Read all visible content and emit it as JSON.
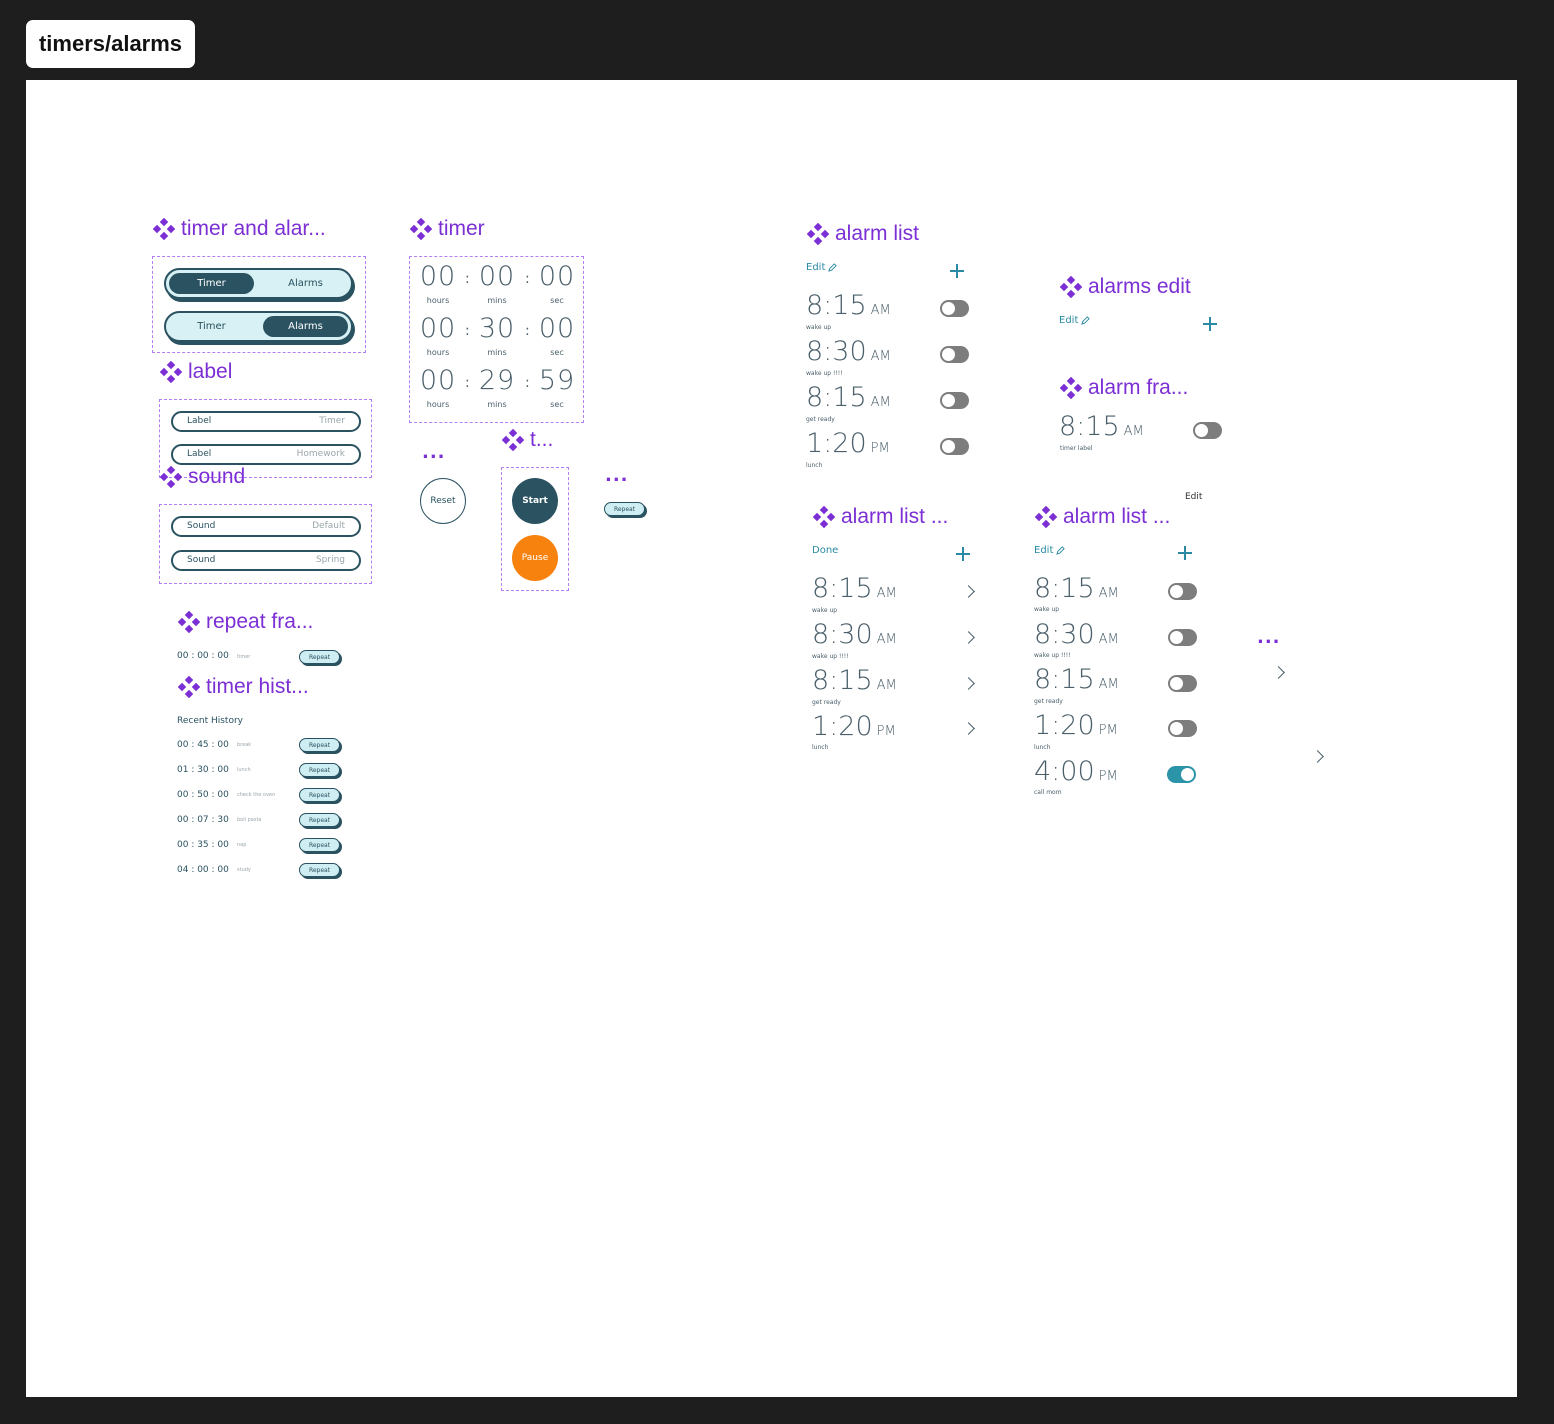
{
  "frame_title": "timers/alarms",
  "components": {
    "toggle_group": {
      "title": "timer and alar...",
      "rows": [
        {
          "left": "Timer",
          "right": "Alarms",
          "active": "left"
        },
        {
          "left": "Timer",
          "right": "Alarms",
          "active": "right"
        }
      ]
    },
    "label": {
      "title": "label",
      "rows": [
        {
          "name": "Label",
          "value": "Timer"
        },
        {
          "name": "Label",
          "value": "Homework"
        }
      ]
    },
    "sound": {
      "title": "sound",
      "rows": [
        {
          "name": "Sound",
          "value": "Default"
        },
        {
          "name": "Sound",
          "value": "Spring"
        }
      ]
    },
    "timer": {
      "title": "timer",
      "rows": [
        {
          "h": "00",
          "m": "00",
          "s": "00"
        },
        {
          "h": "00",
          "m": "30",
          "s": "00"
        },
        {
          "h": "00",
          "m": "29",
          "s": "59"
        }
      ],
      "labels": {
        "hours": "hours",
        "mins": "mins",
        "sec": "sec"
      },
      "colon": ":"
    },
    "reset": {
      "dots": "...",
      "label": "Reset"
    },
    "timer_controls": {
      "title": "t...",
      "start": "Start",
      "pause": "Pause"
    },
    "repeat_button": {
      "dots": "...",
      "label": "Repeat"
    },
    "repeat_frame": {
      "title": "repeat fra...",
      "time": "00 : 00 : 00",
      "note": "timer",
      "button": "Repeat"
    },
    "timer_history": {
      "title": "timer hist...",
      "heading": "Recent History",
      "items": [
        {
          "time": "00 : 45 : 00",
          "note": "break",
          "button": "Repeat"
        },
        {
          "time": "01 : 30 : 00",
          "note": "lunch",
          "button": "Repeat"
        },
        {
          "time": "00 : 50 : 00",
          "note": "check the oven",
          "button": "Repeat"
        },
        {
          "time": "00 : 07 : 30",
          "note": "boil pasta",
          "button": "Repeat"
        },
        {
          "time": "00 : 35 : 00",
          "note": "nap",
          "button": "Repeat"
        },
        {
          "time": "04 : 00 : 00",
          "note": "study",
          "button": "Repeat"
        }
      ]
    },
    "alarm_list": {
      "title": "alarm list",
      "edit": "Edit",
      "items": [
        {
          "time": "8:15",
          "ampm": "AM",
          "note": "wake up",
          "on": false
        },
        {
          "time": "8:30",
          "ampm": "AM",
          "note": "wake up !!!!",
          "on": false
        },
        {
          "time": "8:15",
          "ampm": "AM",
          "note": "get ready",
          "on": false
        },
        {
          "time": "1:20",
          "ampm": "PM",
          "note": "lunch",
          "on": false
        }
      ]
    },
    "alarms_edit": {
      "title": "alarms edit",
      "edit": "Edit"
    },
    "alarm_frame": {
      "title": "alarm fra...",
      "time": "8:15",
      "ampm": "AM",
      "note": "timer label",
      "on": false,
      "floating_edit": "Edit"
    },
    "alarm_list_editing": {
      "title": "alarm list ...",
      "done": "Done",
      "items": [
        {
          "time": "8:15",
          "ampm": "AM",
          "note": "wake up"
        },
        {
          "time": "8:30",
          "ampm": "AM",
          "note": "wake up !!!!"
        },
        {
          "time": "8:15",
          "ampm": "AM",
          "note": "get ready"
        },
        {
          "time": "1:20",
          "ampm": "PM",
          "note": "lunch"
        }
      ]
    },
    "alarm_list_new": {
      "title": "alarm list ...",
      "edit": "Edit",
      "items": [
        {
          "time": "8:15",
          "ampm": "AM",
          "note": "wake up",
          "on": false
        },
        {
          "time": "8:30",
          "ampm": "AM",
          "note": "wake up !!!!",
          "on": false
        },
        {
          "time": "8:15",
          "ampm": "AM",
          "note": "get ready",
          "on": false
        },
        {
          "time": "1:20",
          "ampm": "PM",
          "note": "lunch",
          "on": false
        },
        {
          "time": "4:00",
          "ampm": "PM",
          "note": "call mom",
          "on": true
        }
      ]
    },
    "chevron_component": {
      "dots": "..."
    }
  },
  "colors": {
    "accent_purple": "#7b2fd4",
    "dark_teal": "#2a5260",
    "light_teal": "#d8f1f4",
    "toggle_on": "#2b94a8",
    "toggle_off": "#7d7d7d",
    "pause_orange": "#f7820d",
    "canvas_bg": "#1e1e1e"
  },
  "icons": [
    "component-icon",
    "pencil-icon",
    "plus-icon",
    "chevron-right-icon"
  ]
}
